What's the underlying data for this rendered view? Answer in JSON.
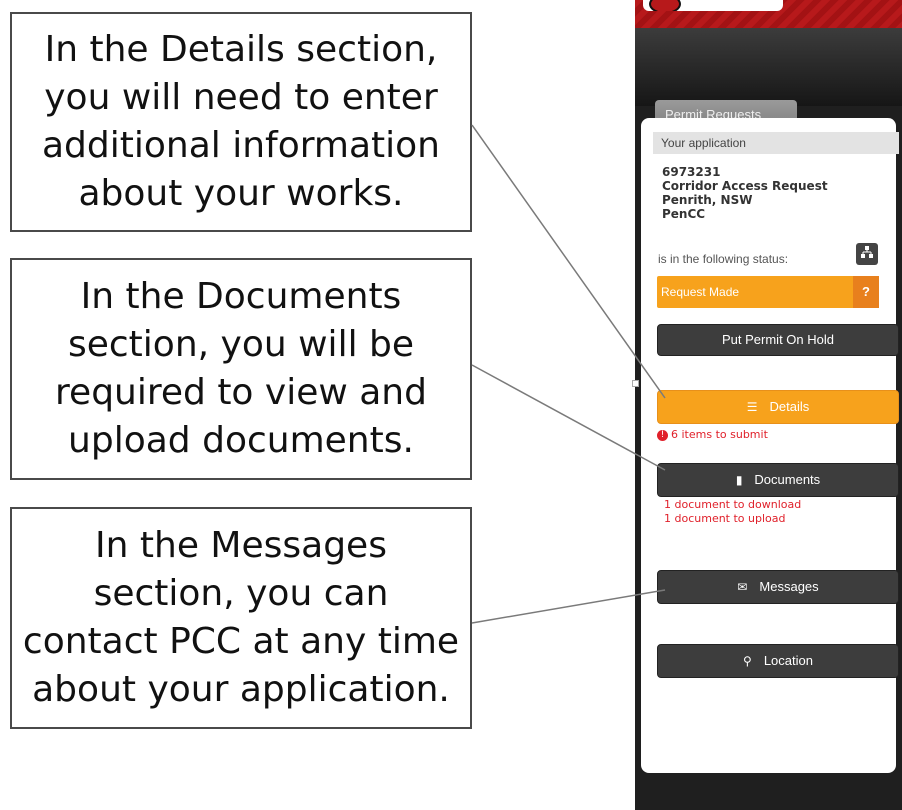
{
  "callouts": {
    "details": "In the Details section,\nyou will need to enter\nadditional information\nabout your works.",
    "documents": "In the Documents\nsection, you will be\nrequired to view and\nupload documents.",
    "messages": "In the Messages\nsection, you can\ncontact PCC at any time\nabout your application."
  },
  "tab": {
    "label": "Permit Requests"
  },
  "application": {
    "header": "Your application",
    "id": "6973231",
    "type": "Corridor Access Request",
    "location": "Penrith, NSW",
    "council": "PenCC",
    "status_label": "is in the following status:",
    "status": "Request Made",
    "help": "?"
  },
  "buttons": {
    "hold": "Put Permit On Hold",
    "details": "Details",
    "documents": "Documents",
    "messages": "Messages",
    "location": "Location"
  },
  "notes": {
    "details": "6 items to submit",
    "documents_download": "1 document to download",
    "documents_upload": "1 document to upload"
  },
  "icons": {
    "details": "list-icon",
    "documents": "document-icon",
    "messages": "envelope-icon",
    "location": "map-pin-icon",
    "status_tree": "org-chart-icon",
    "warning": "exclamation-icon"
  },
  "colors": {
    "accent_orange": "#f7a21c",
    "header_red": "#b7191b",
    "alert_red": "#e0212b",
    "button_dark": "#3d3d3d"
  }
}
